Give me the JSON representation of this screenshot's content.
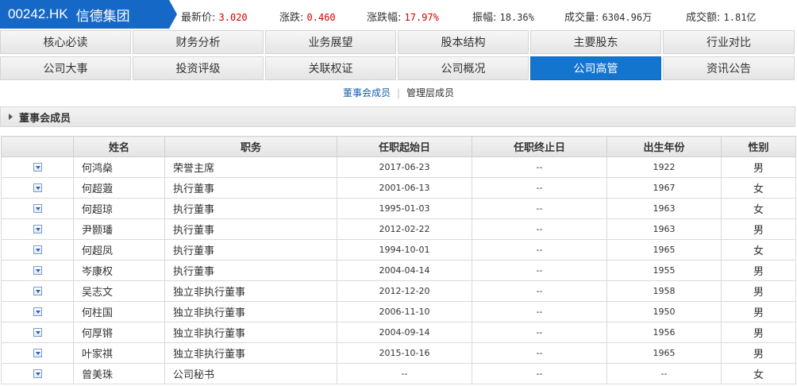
{
  "header": {
    "code": "00242.HK",
    "name": "信德集团",
    "quotes": [
      {
        "label": "最新价:",
        "value": "3.020"
      },
      {
        "label": "涨跌:",
        "value": "0.460"
      },
      {
        "label": "涨跌幅:",
        "value": "17.97%"
      },
      {
        "label": "振幅:",
        "value": "18.36%"
      },
      {
        "label": "成交量:",
        "value": "6304.96万"
      },
      {
        "label": "成交额:",
        "value": "1.81亿"
      }
    ]
  },
  "nav": {
    "row1": [
      "核心必读",
      "财务分析",
      "业务展望",
      "股本结构",
      "主要股东",
      "行业对比"
    ],
    "row2": [
      "公司大事",
      "投资评级",
      "关联权证",
      "公司概况",
      "公司高管",
      "资讯公告"
    ],
    "active": "公司高管"
  },
  "subtabs": {
    "board": "董事会成员",
    "management": "管理层成员"
  },
  "section": {
    "title": "董事会成员"
  },
  "table": {
    "headers": [
      "",
      "姓名",
      "职务",
      "任职起始日",
      "任职终止日",
      "出生年份",
      "性别"
    ],
    "rows": [
      [
        "何鸿燊",
        "荣誉主席",
        "2017-06-23",
        "--",
        "1922",
        "男"
      ],
      [
        "何超蕸",
        "执行董事",
        "2001-06-13",
        "--",
        "1967",
        "女"
      ],
      [
        "何超琼",
        "执行董事",
        "1995-01-03",
        "--",
        "1963",
        "女"
      ],
      [
        "尹颢璠",
        "执行董事",
        "2012-02-22",
        "--",
        "1963",
        "男"
      ],
      [
        "何超凤",
        "执行董事",
        "1994-10-01",
        "--",
        "1965",
        "女"
      ],
      [
        "岑康权",
        "执行董事",
        "2004-04-14",
        "--",
        "1955",
        "男"
      ],
      [
        "吴志文",
        "独立非执行董事",
        "2012-12-20",
        "--",
        "1958",
        "男"
      ],
      [
        "何柱国",
        "独立非执行董事",
        "2006-11-10",
        "--",
        "1950",
        "男"
      ],
      [
        "何厚锵",
        "独立非执行董事",
        "2004-09-14",
        "--",
        "1956",
        "男"
      ],
      [
        "叶家祺",
        "独立非执行董事",
        "2015-10-16",
        "--",
        "1965",
        "男"
      ],
      [
        "曾美珠",
        "公司秘书",
        "--",
        "--",
        "--",
        "女"
      ]
    ]
  },
  "colors": {
    "brand": "#1668c7",
    "accent": "#1475cf",
    "up": "#d40000"
  }
}
